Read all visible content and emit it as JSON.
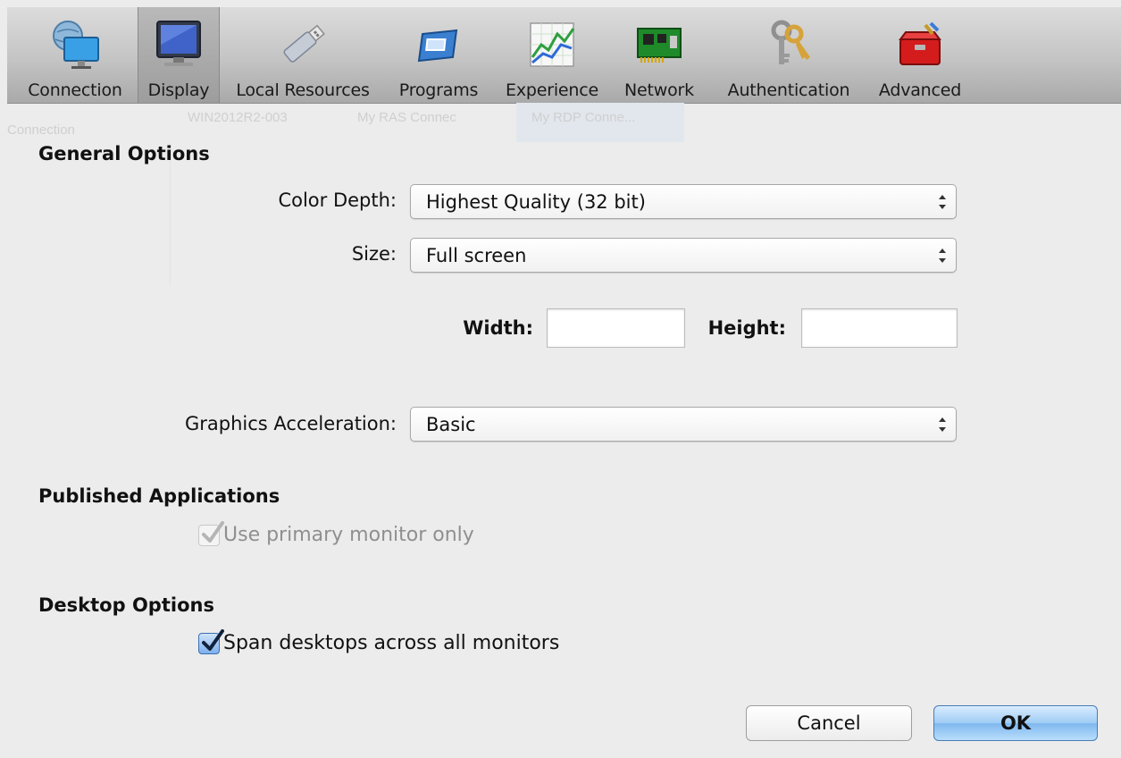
{
  "toolbar": {
    "items": [
      {
        "label": "Connection",
        "icon": "monitor-globe-icon"
      },
      {
        "label": "Display",
        "icon": "display-monitor-icon",
        "selected": true
      },
      {
        "label": "Local Resources",
        "icon": "usb-drive-icon"
      },
      {
        "label": "Programs",
        "icon": "program-window-icon"
      },
      {
        "label": "Experience",
        "icon": "graph-icon"
      },
      {
        "label": "Network",
        "icon": "network-card-icon"
      },
      {
        "label": "Authentication",
        "icon": "keys-icon"
      },
      {
        "label": "Advanced",
        "icon": "toolbox-icon"
      }
    ]
  },
  "background_ghost": {
    "left": "Connection",
    "t1": "WIN2012R2-003",
    "t2": "My RAS Connec",
    "t3": "My RDP Conne..."
  },
  "general": {
    "title": "General Options",
    "color_depth_label": "Color Depth:",
    "color_depth_value": "Highest Quality (32 bit)",
    "size_label": "Size:",
    "size_value": "Full screen",
    "width_label": "Width:",
    "width_value": "",
    "height_label": "Height:",
    "height_value": "",
    "graphics_label": "Graphics Acceleration:",
    "graphics_value": "Basic"
  },
  "published": {
    "title": "Published Applications",
    "primary_monitor_label": "Use primary monitor only",
    "primary_monitor_checked": true,
    "primary_monitor_enabled": false
  },
  "desktop": {
    "title": "Desktop Options",
    "span_label": "Span desktops across all monitors",
    "span_checked": true
  },
  "buttons": {
    "cancel": "Cancel",
    "ok": "OK"
  },
  "colors": {
    "accent": "#7fb8ef",
    "background": "#ececec"
  }
}
